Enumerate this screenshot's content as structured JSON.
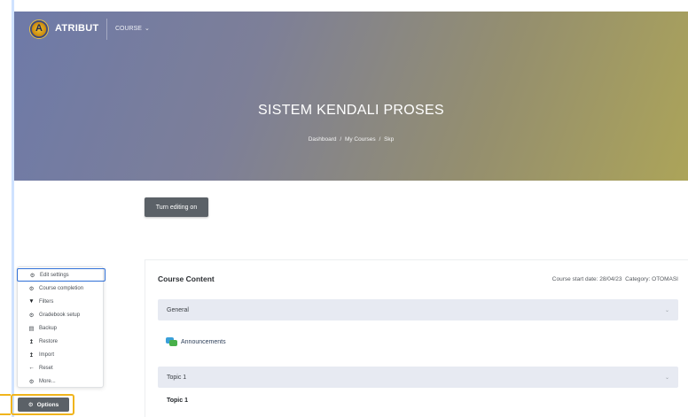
{
  "header": {
    "brand": "ATRIBUT",
    "course_menu_label": "COURSE",
    "logo_letter": "A"
  },
  "hero": {
    "title": "SISTEM KENDALI PROSES",
    "breadcrumb": [
      "Dashboard",
      "My Courses",
      "Skp"
    ],
    "separator": "/"
  },
  "editing": {
    "button_label": "Turn editing on"
  },
  "course_content": {
    "title": "Course Content",
    "meta": "Course start date: 28/04/23  Category: OTOMASI",
    "sections": [
      {
        "title": "General"
      },
      {
        "title": "Topic 1"
      }
    ],
    "activity": "Announcements",
    "topic_heading": "Topic 1"
  },
  "options_menu": {
    "items": [
      {
        "label": "Edit settings",
        "icon": "gear-icon"
      },
      {
        "label": "Course completion",
        "icon": "gear-icon"
      },
      {
        "label": "Filters",
        "icon": "filter-icon"
      },
      {
        "label": "Gradebook setup",
        "icon": "gear-icon"
      },
      {
        "label": "Backup",
        "icon": "file-icon"
      },
      {
        "label": "Restore",
        "icon": "upload-icon"
      },
      {
        "label": "Import",
        "icon": "upload-icon"
      },
      {
        "label": "Reset",
        "icon": "arrow-left-icon"
      },
      {
        "label": "More...",
        "icon": "gear-icon"
      }
    ],
    "button_label": "Options"
  },
  "colors": {
    "accent": "#2f6fd6",
    "highlight": "#f0b41c",
    "button": "#5b6167",
    "section_bar": "#e7eaf2"
  }
}
